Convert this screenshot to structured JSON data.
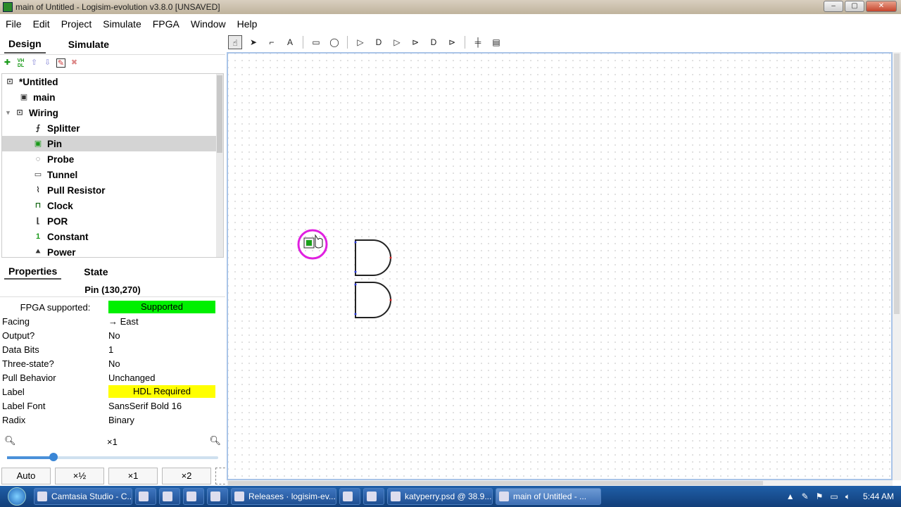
{
  "window": {
    "title": "main of Untitled - Logisim-evolution v3.8.0 [UNSAVED]",
    "min": "–",
    "max": "▢",
    "close": "✕"
  },
  "menu": [
    "File",
    "Edit",
    "Project",
    "Simulate",
    "FPGA",
    "Window",
    "Help"
  ],
  "explorer": {
    "tabs": [
      "Design",
      "Simulate"
    ],
    "tools": [
      "add-icon",
      "vhdl-icon",
      "move-up-icon",
      "move-down-icon",
      "edit-icon",
      "delete-icon"
    ],
    "tools_labels": {
      "vhdl": "VH DL"
    },
    "tree": [
      {
        "label": "*Untitled",
        "icon": "project-icon",
        "indent": 0,
        "sel": false,
        "expand": ""
      },
      {
        "label": "main",
        "icon": "circuit-icon",
        "indent": 1,
        "sel": false,
        "expand": ""
      },
      {
        "label": "Wiring",
        "icon": "folder-icon",
        "indent": 0,
        "sel": false,
        "expand": "▼"
      },
      {
        "label": "Splitter",
        "icon": "splitter-icon",
        "indent": 2,
        "sel": false,
        "expand": ""
      },
      {
        "label": "Pin",
        "icon": "pin-icon",
        "indent": 2,
        "sel": true,
        "expand": ""
      },
      {
        "label": "Probe",
        "icon": "probe-icon",
        "indent": 2,
        "sel": false,
        "expand": ""
      },
      {
        "label": "Tunnel",
        "icon": "tunnel-icon",
        "indent": 2,
        "sel": false,
        "expand": ""
      },
      {
        "label": "Pull Resistor",
        "icon": "pull-resistor-icon",
        "indent": 2,
        "sel": false,
        "expand": ""
      },
      {
        "label": "Clock",
        "icon": "clock-icon",
        "indent": 2,
        "sel": false,
        "expand": ""
      },
      {
        "label": "POR",
        "icon": "por-icon",
        "indent": 2,
        "sel": false,
        "expand": ""
      },
      {
        "label": "Constant",
        "icon": "constant-icon",
        "indent": 2,
        "sel": false,
        "expand": ""
      },
      {
        "label": "Power",
        "icon": "power-icon",
        "indent": 2,
        "sel": false,
        "expand": ""
      }
    ]
  },
  "properties": {
    "tabs": [
      "Properties",
      "State"
    ],
    "title": "Pin (130,270)",
    "rows": [
      {
        "k": "FPGA supported:",
        "v": "Supported",
        "style": "green",
        "kcenter": true
      },
      {
        "k": "Facing",
        "v": "→ East",
        "style": "",
        "kcenter": false
      },
      {
        "k": "Output?",
        "v": "No",
        "style": "",
        "kcenter": false
      },
      {
        "k": "Data Bits",
        "v": "1",
        "style": "",
        "kcenter": false
      },
      {
        "k": "Three-state?",
        "v": "No",
        "style": "",
        "kcenter": false
      },
      {
        "k": "Pull Behavior",
        "v": "Unchanged",
        "style": "",
        "kcenter": false
      },
      {
        "k": "Label",
        "v": "HDL Required",
        "style": "yellow",
        "kcenter": false
      },
      {
        "k": "Label Font",
        "v": "SansSerif Bold 16",
        "style": "",
        "kcenter": false
      },
      {
        "k": "Radix",
        "v": "Binary",
        "style": "",
        "kcenter": false
      }
    ]
  },
  "zoom": {
    "current": "×1",
    "level": 0.22,
    "buttons": [
      "Auto",
      "×½",
      "×1",
      "×2"
    ]
  },
  "toolbar": [
    {
      "name": "poke-tool-icon",
      "glyph": "☝",
      "on": true
    },
    {
      "name": "select-tool-icon",
      "glyph": "➤",
      "on": false
    },
    {
      "name": "wire-tool-icon",
      "glyph": "⌐",
      "on": false
    },
    {
      "name": "text-tool-icon",
      "glyph": "A",
      "on": false
    },
    {
      "sep": true
    },
    {
      "name": "input-pin-icon",
      "glyph": "▭",
      "on": false
    },
    {
      "name": "output-pin-icon",
      "glyph": "◯",
      "on": false
    },
    {
      "sep": true
    },
    {
      "name": "not-gate-icon",
      "glyph": "▷",
      "on": false
    },
    {
      "name": "and-gate-icon",
      "glyph": "D",
      "on": false
    },
    {
      "name": "buffer-icon",
      "glyph": "▷",
      "on": false
    },
    {
      "name": "xor-gate-icon",
      "glyph": "⊳",
      "on": false
    },
    {
      "name": "nand-gate-icon",
      "glyph": "D",
      "on": false
    },
    {
      "name": "nor-gate-icon",
      "glyph": "⊳",
      "on": false
    },
    {
      "sep": true
    },
    {
      "name": "splitter-tool-icon",
      "glyph": "╪",
      "on": false
    },
    {
      "name": "subcircuit-icon",
      "glyph": "▤",
      "on": false
    }
  ],
  "colors": {
    "accent": "#3a86d6",
    "selected": "#d4d4d4",
    "supported": "#00f000",
    "required": "#ffff00",
    "highlight": "#e020e0"
  },
  "taskbar": {
    "items": [
      {
        "label": "Camtasia Studio - C...",
        "w": 140,
        "active": false
      },
      {
        "label": "",
        "w": 30,
        "active": false
      },
      {
        "label": "",
        "w": 30,
        "active": false
      },
      {
        "label": "",
        "w": 30,
        "active": false
      },
      {
        "label": "",
        "w": 30,
        "active": false
      },
      {
        "label": "Releases · logisim-ev...",
        "w": 150,
        "active": false
      },
      {
        "label": "",
        "w": 30,
        "active": false
      },
      {
        "label": "",
        "w": 30,
        "active": false
      },
      {
        "label": "katyperry.psd @ 38.9...",
        "w": 150,
        "active": false
      },
      {
        "label": "main of Untitled - ...",
        "w": 150,
        "active": true
      }
    ],
    "time": "5:44 AM"
  }
}
